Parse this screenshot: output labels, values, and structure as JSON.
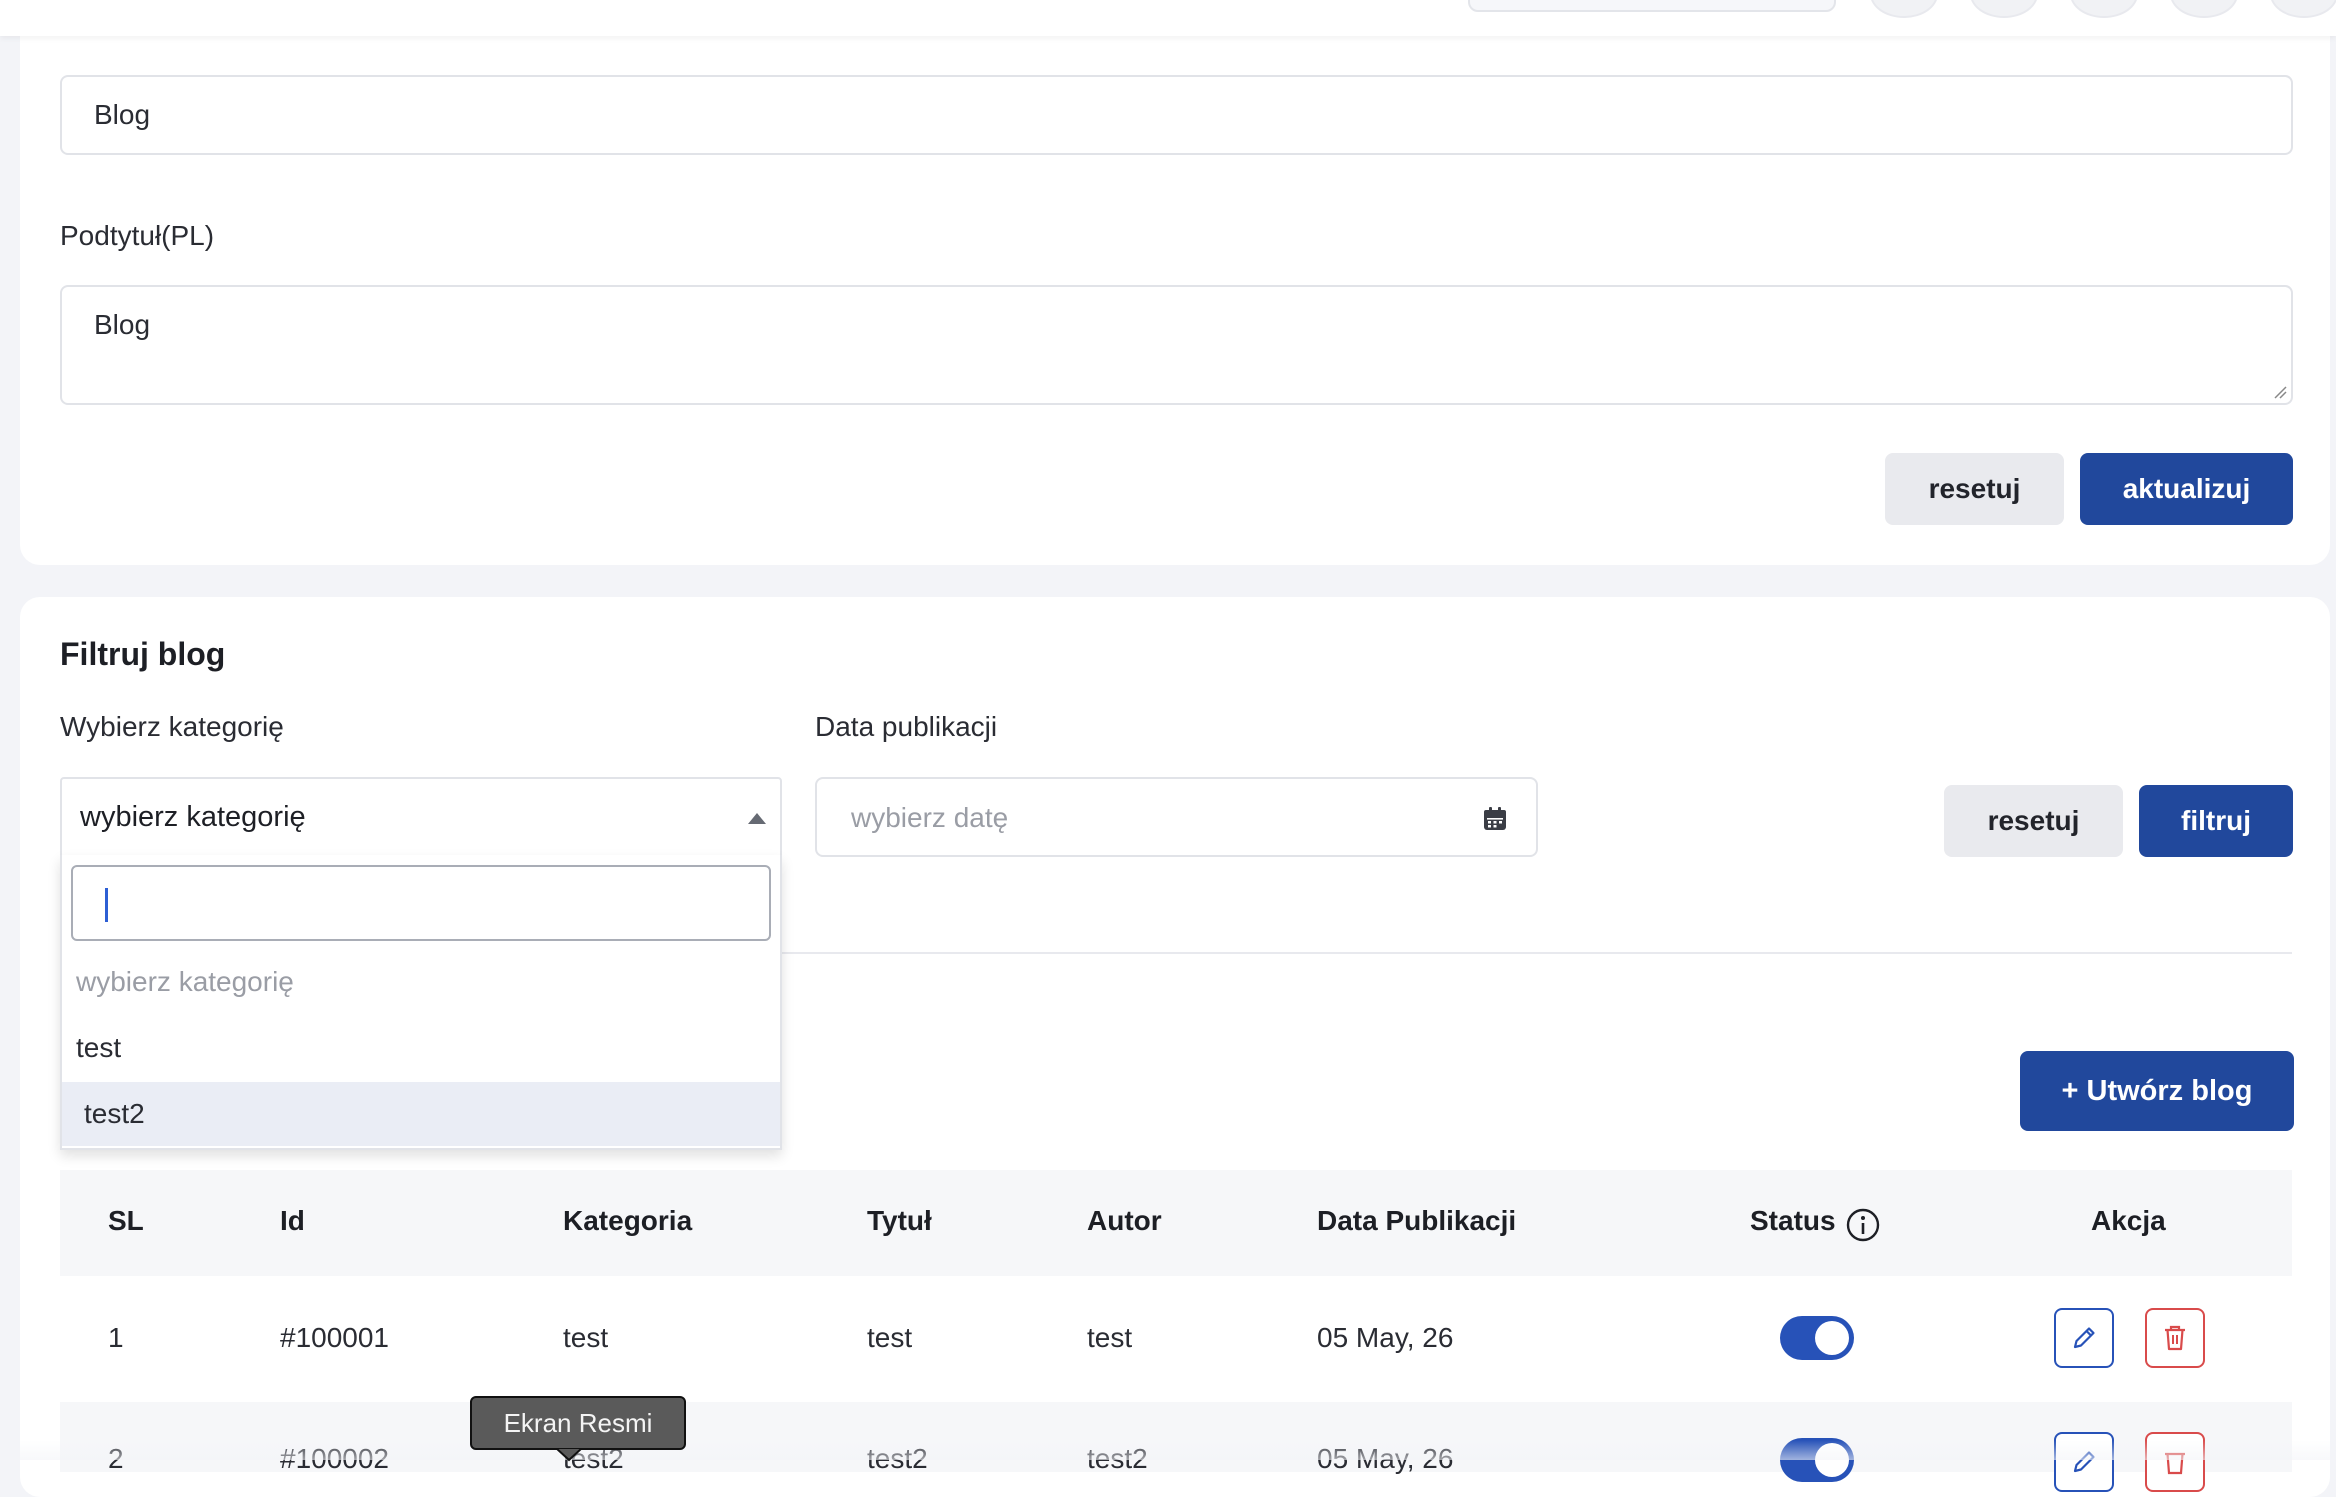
{
  "blog_form": {
    "title_value": "Blog",
    "subtitle_label": "Podtytuł(PL)",
    "subtitle_value": "Blog",
    "reset_label": "resetuj",
    "update_label": "aktualizuj"
  },
  "filter": {
    "heading": "Filtruj blog",
    "category_label": "Wybierz kategorię",
    "category_selected": "wybierz kategorię",
    "date_label": "Data publikacji",
    "date_placeholder": "wybierz datę",
    "reset_label": "resetuj",
    "filter_label": "filtruj",
    "dropdown_options": [
      "wybierz kategorię",
      "test",
      "test2"
    ]
  },
  "create_button_label": "+ Utwórz blog",
  "table": {
    "headers": {
      "sl": "SL",
      "id": "Id",
      "category": "Kategoria",
      "title": "Tytuł",
      "author": "Autor",
      "date": "Data Publikacji",
      "status": "Status",
      "action": "Akcja"
    },
    "rows": [
      {
        "sl": "1",
        "id": "#100001",
        "category": "test",
        "title": "test",
        "author": "test",
        "date": "05 May, 26",
        "status_on": true
      },
      {
        "sl": "2",
        "id": "#100002",
        "category": "test2",
        "title": "test2",
        "author": "test2",
        "date": "05 May, 26",
        "status_on": true
      }
    ]
  },
  "tooltip": "Ekran Resmi",
  "colors": {
    "primary": "#21489c",
    "danger": "#d94b4b",
    "toggle_on": "#2752b8"
  }
}
